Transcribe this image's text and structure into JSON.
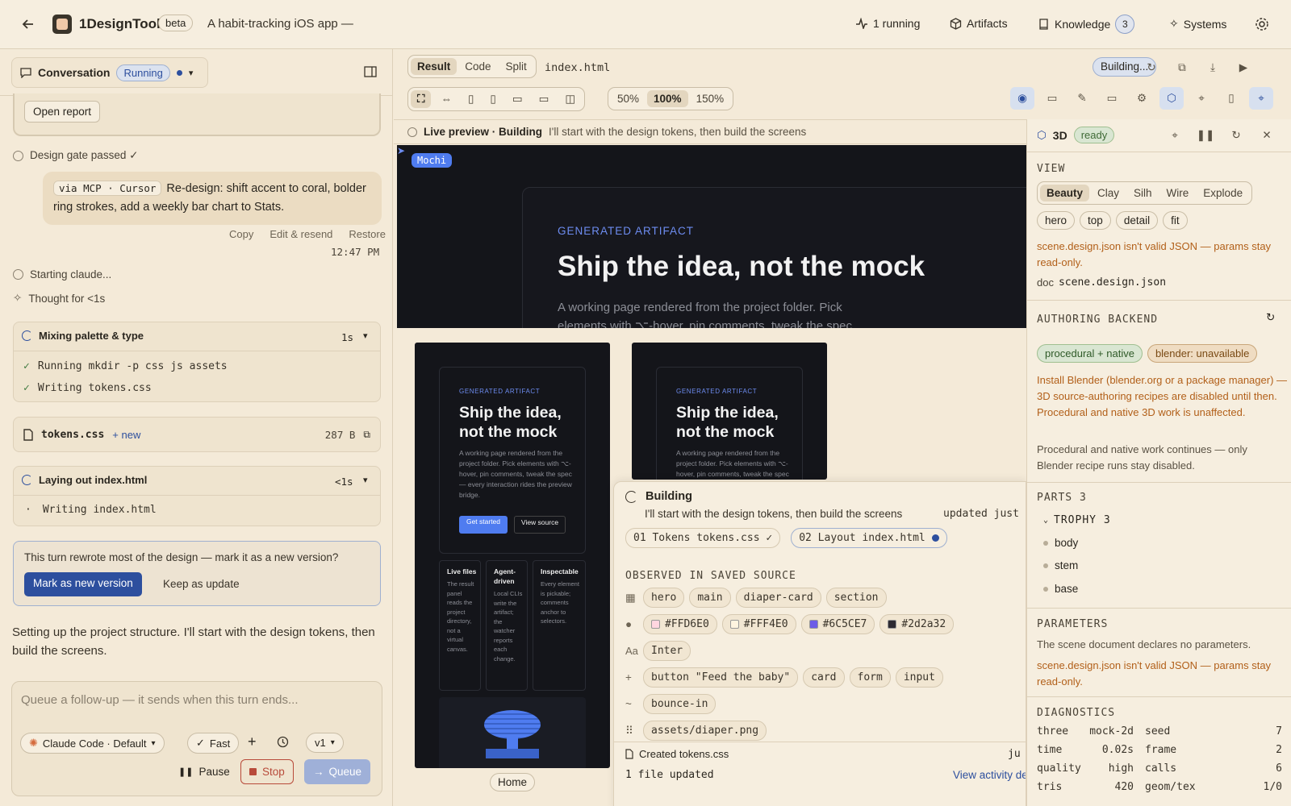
{
  "topbar": {
    "app_name": "1DesignTool",
    "beta": "beta",
    "project": "A habit-tracking iOS app —",
    "running": "1 running",
    "artifacts": "Artifacts",
    "knowledge": "Knowledge",
    "knowledge_count": "3",
    "systems": "Systems"
  },
  "left": {
    "conv_label": "Conversation",
    "conv_status": "Running",
    "open_report": "Open report",
    "gate": "Design gate passed ✓",
    "msg_via": "via MCP · Cursor",
    "msg_text": "Re-design: shift accent to coral, bolder ring strokes, add a weekly bar chart to Stats.",
    "copy": "Copy",
    "edit": "Edit & resend",
    "restore": "Restore",
    "time": "12:47 PM",
    "starting": "Starting claude...",
    "thought": "Thought for <1s",
    "step1_title": "Mixing palette & type",
    "step1_time": "1s",
    "step1_items": [
      "Running mkdir -p css js assets",
      "Writing tokens.css"
    ],
    "file_name": "tokens.css",
    "file_new": "+ new",
    "file_size": "287 B",
    "step2_title": "Laying out index.html",
    "step2_time": "<1s",
    "step2_item": "Writing index.html",
    "version_q": "This turn rewrote most of the design — mark it as a new version?",
    "mark_btn": "Mark as new version",
    "keep_btn": "Keep as update",
    "setup_text": "Setting up the project structure. I'll start with the design tokens, then build the screens.",
    "composer_placeholder": "Queue a follow-up — it sends when this turn ends...",
    "model": "Claude Code · Default",
    "fast": "Fast",
    "version": "v1",
    "pause": "Pause",
    "stop": "Stop",
    "queue": "Queue"
  },
  "preview": {
    "tabs": [
      "Result",
      "Code",
      "Split"
    ],
    "file": "index.html",
    "building": "Building...",
    "zoom": [
      "50%",
      "100%",
      "150%"
    ],
    "live_label": "Live preview · Building",
    "live_text": "I'll start with the design tokens, then build the screens",
    "cursor_tag": "Mochi",
    "hero_kicker": "GENERATED ARTIFACT",
    "hero_title": "Ship the idea, not the mock",
    "hero_sub": "A working page rendered from the project folder. Pick elements with ⌥-hover, pin comments, tweak the spec",
    "phone_kicker": "GENERATED ARTIFACT",
    "phone_title": "Ship the idea, not the mock",
    "phone_sub": "A working page rendered from the project folder. Pick elements with ⌥-hover, pin comments, tweak the spec — every interaction rides the preview bridge.",
    "phone_btn1": "Get started",
    "phone_btn2": "View source",
    "cols": [
      {
        "h": "Live files",
        "t": "The result panel reads the project directory, not a virtual canvas."
      },
      {
        "h": "Agent-driven",
        "t": "Local CLIs write the artifact; the watcher reports each change."
      },
      {
        "h": "Inspectable",
        "t": "Every element is pickable; comments anchor to selectors."
      }
    ],
    "home": "Home"
  },
  "activity": {
    "title": "Building",
    "sub": "I'll start with the design tokens, then build the screens",
    "updated": "updated just",
    "step1": "01 Tokens tokens.css ✓",
    "step2": "02 Layout index.html",
    "observed": "OBSERVED IN SAVED SOURCE",
    "tags1": [
      "hero",
      "main",
      "diaper-card",
      "section"
    ],
    "colors": [
      {
        "hex": "#FFD6E0",
        "c": "#FFD6E0"
      },
      {
        "hex": "#FFF4E0",
        "c": "#FFF4E0"
      },
      {
        "hex": "#6C5CE7",
        "c": "#6C5CE7"
      },
      {
        "hex": "#2d2a32",
        "c": "#2d2a32"
      }
    ],
    "font": "Inter",
    "aa": "Aa",
    "tags2": [
      "button \"Feed the baby\"",
      "card",
      "form",
      "input"
    ],
    "tags3": [
      "bounce-in"
    ],
    "tags4": [
      "assets/diaper.png"
    ],
    "created": "Created tokens.css",
    "created_time": "ju",
    "files": "1 file updated",
    "view_activity": "View activity de"
  },
  "side": {
    "label": "3D",
    "status": "ready",
    "view": "VIEW",
    "modes": [
      "Beauty",
      "Clay",
      "Silh",
      "Wire",
      "Explode"
    ],
    "cams": [
      "hero",
      "top",
      "detail",
      "fit"
    ],
    "warn1": "scene.design.json isn't valid JSON — params stay read-only.",
    "doc_label": "doc",
    "doc_file": "scene.design.json",
    "backend": "AUTHORING BACKEND",
    "be1": "procedural + native",
    "be2": "blender: unavailable",
    "install": "Install Blender (blender.org or a package manager) — 3D source-authoring recipes are disabled until then. Procedural and native 3D work is unaffected.",
    "note": "Procedural and native work continues — only Blender recipe runs stay disabled.",
    "parts": "PARTS 3",
    "group": "TROPHY 3",
    "items": [
      "body",
      "stem",
      "base"
    ],
    "params": "PARAMETERS",
    "params_note": "The scene document declares no parameters.",
    "warn2": "scene.design.json isn't valid JSON — params stay read-only.",
    "diag": "DIAGNOSTICS",
    "diag_rows": [
      [
        "three",
        "mock-2d",
        "seed",
        "7"
      ],
      [
        "time",
        "0.02s",
        "frame",
        "2"
      ],
      [
        "quality",
        "high",
        "calls",
        "6"
      ],
      [
        "tris",
        "420",
        "geom/tex",
        "1/0"
      ]
    ]
  },
  "colors": {
    "accent": "#2d4f9e",
    "warn": "#b2601a",
    "ok": "#3f7a3f"
  }
}
